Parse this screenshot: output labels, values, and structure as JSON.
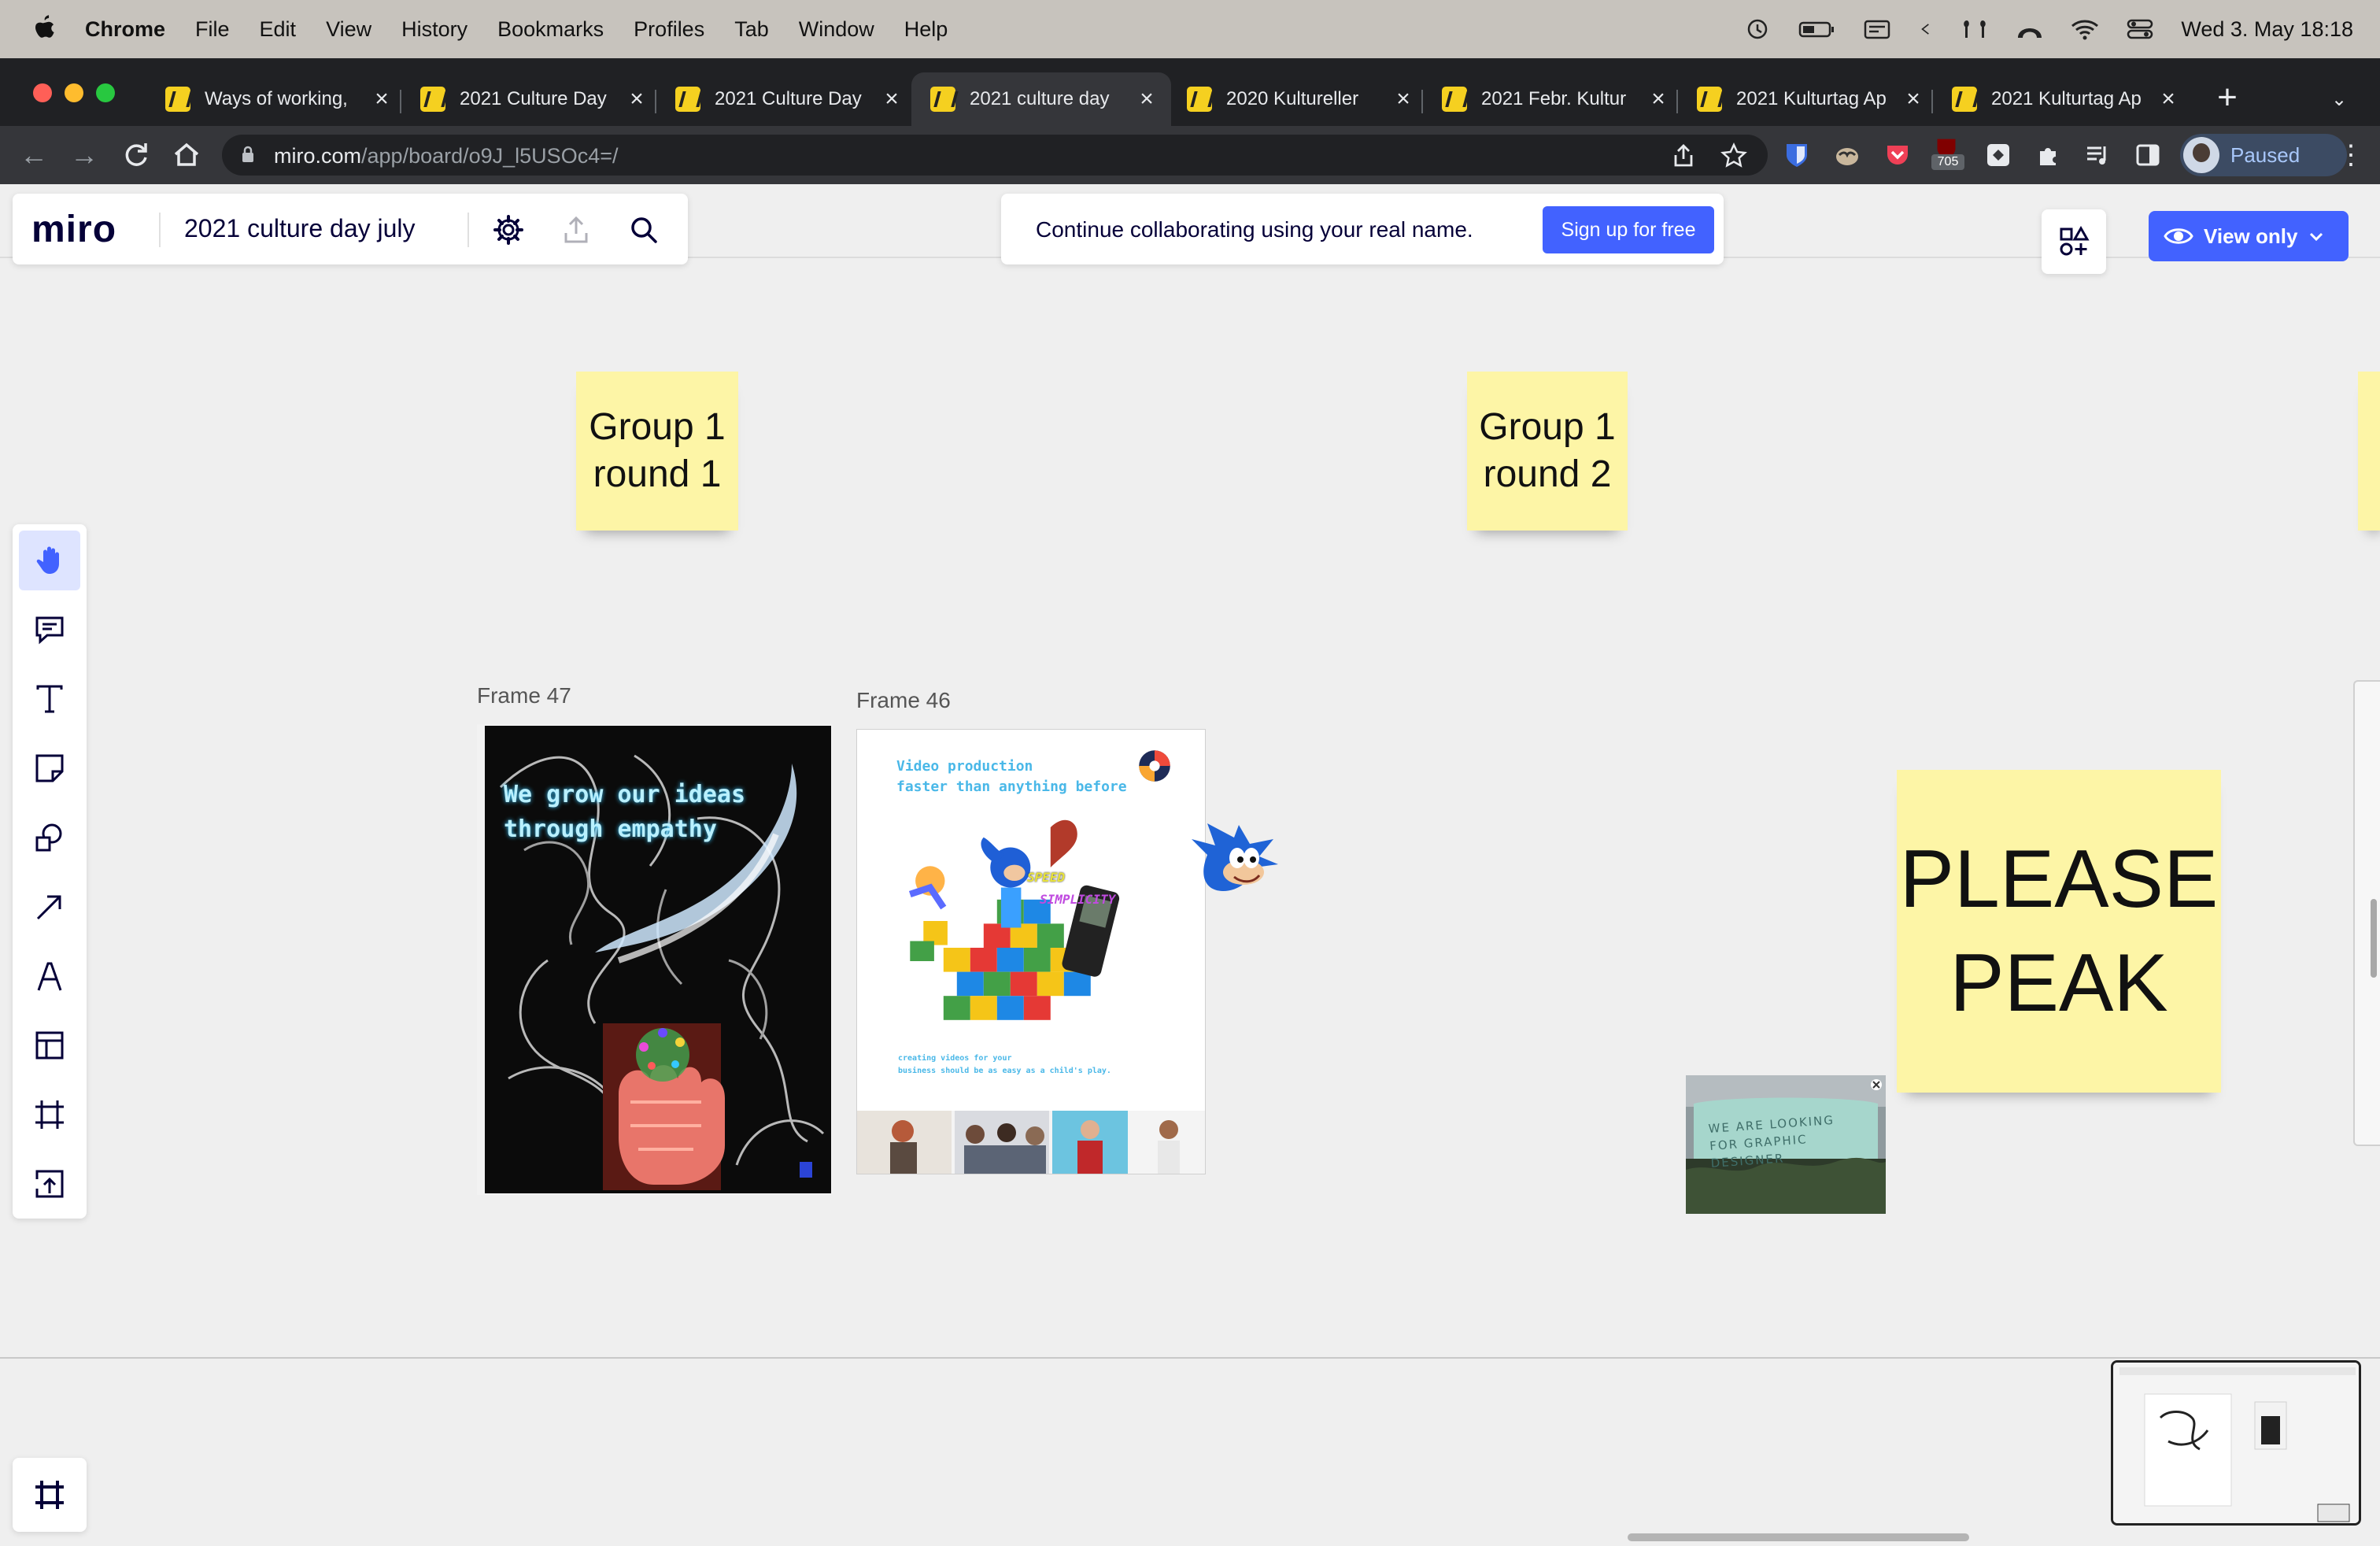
{
  "menubar": {
    "app": "Chrome",
    "items": [
      "File",
      "Edit",
      "View",
      "History",
      "Bookmarks",
      "Profiles",
      "Tab",
      "Window",
      "Help"
    ],
    "clock": "Wed 3. May  18:18"
  },
  "tabs": [
    {
      "title": "Ways of working,"
    },
    {
      "title": "2021 Culture Day"
    },
    {
      "title": "2021 Culture Day"
    },
    {
      "title": "2021 culture day"
    },
    {
      "title": "2020 Kultureller"
    },
    {
      "title": "2021 Febr. Kultur"
    },
    {
      "title": "2021 Kulturtag Ap"
    },
    {
      "title": "2021 Kulturtag Ap"
    }
  ],
  "address": {
    "host": "miro.com",
    "path": "/app/board/o9J_l5USOc4=/"
  },
  "extensions": {
    "badge": "705",
    "profile_label": "Paused"
  },
  "miro": {
    "logo": "miro",
    "board_title": "2021 culture day july",
    "banner_text": "Continue collaborating using your real name.",
    "signup_label": "Sign up for free",
    "view_only_label": "View only"
  },
  "board": {
    "sticky1": {
      "line1": "Group 1",
      "line2": "round 1"
    },
    "sticky2": {
      "line1": "Group 1",
      "line2": "round 2"
    },
    "sticky_big": {
      "line1": "PLEASE",
      "line2": "PEAK"
    },
    "frame47": {
      "label": "Frame 47",
      "poster_text_1": "We grow our ideas",
      "poster_text_2": "through empathy"
    },
    "frame46": {
      "label": "Frame 46",
      "headline_1": "Video production",
      "headline_2": "faster than anything before",
      "word_speed": "SPEED",
      "word_simplicity": "SIMPLICITY",
      "footer_1": "creating videos for your",
      "footer_2": "business should be as easy as a child's play."
    },
    "photo_caption": "WE ARE LOOKING FOR GRAPHIC DESIGNER"
  },
  "colors": {
    "accent": "#4262ff",
    "sticky": "#fdf5a6",
    "menubar": "#c7c3bd",
    "tabstrip": "#202124"
  }
}
